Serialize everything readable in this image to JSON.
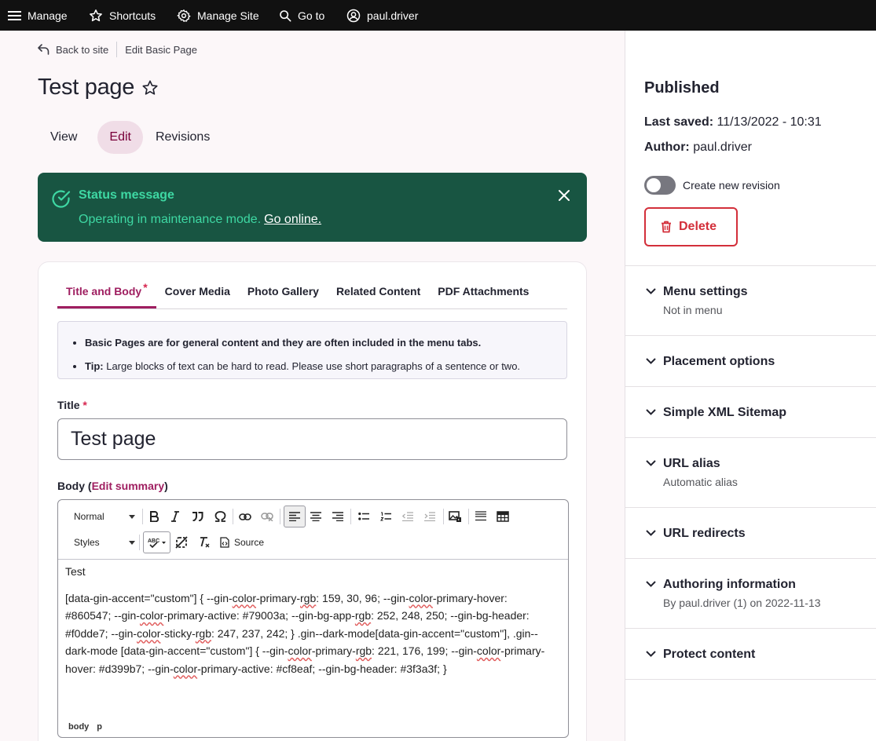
{
  "toolbar": {
    "manage": "Manage",
    "shortcuts": "Shortcuts",
    "manage_site": "Manage Site",
    "goto": "Go to",
    "user": "paul.driver"
  },
  "breadcrumb": {
    "back": "Back to site",
    "current": "Edit Basic Page"
  },
  "page": {
    "title": "Test page"
  },
  "tabs": [
    "View",
    "Edit",
    "Revisions"
  ],
  "status": {
    "title": "Status message",
    "text": "Operating in maintenance mode.",
    "link": "Go online."
  },
  "form": {
    "horizontal_tabs": [
      "Title and Body",
      "Cover Media",
      "Photo Gallery",
      "Related Content",
      "PDF Attachments"
    ],
    "help": {
      "line1": "Basic Pages are for general content and they are often included in the menu tabs.",
      "tip_label": "Tip:",
      "tip_text": "Large blocks of text can be hard to read. Please use short paragraphs of a sentence or two."
    },
    "title_label": "Title",
    "title_value": "Test page",
    "body_label": "Body",
    "edit_summary": "Edit summary",
    "editor": {
      "format": "Normal",
      "styles": "Styles",
      "source": "Source",
      "paragraph1": "Test",
      "path": [
        "body",
        "p"
      ]
    }
  },
  "sidebar": {
    "status": "Published",
    "last_saved_label": "Last saved:",
    "last_saved_value": "11/13/2022 - 10:31",
    "author_label": "Author:",
    "author_value": "paul.driver",
    "revision_label": "Create new revision",
    "delete": "Delete",
    "sections": [
      {
        "title": "Menu settings",
        "sub": "Not in menu"
      },
      {
        "title": "Placement options",
        "sub": ""
      },
      {
        "title": "Simple XML Sitemap",
        "sub": ""
      },
      {
        "title": "URL alias",
        "sub": "Automatic alias"
      },
      {
        "title": "URL redirects",
        "sub": ""
      },
      {
        "title": "Authoring information",
        "sub": "By paul.driver (1) on 2022-11-13"
      },
      {
        "title": "Protect content",
        "sub": ""
      }
    ]
  },
  "colors": {
    "accent": "#9f1e60",
    "status_bg": "#185542",
    "status_text": "#3ed8a3",
    "danger": "#d32f3a"
  }
}
